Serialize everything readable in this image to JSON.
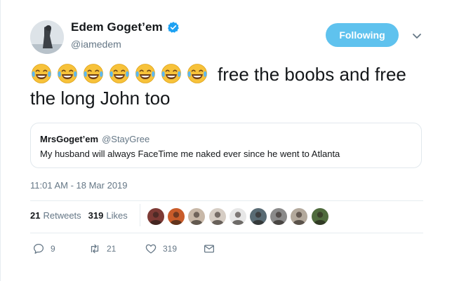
{
  "author": {
    "display_name": "Edem Goget’em",
    "handle": "@iamedem",
    "verified": true
  },
  "follow_button": {
    "label": "Following"
  },
  "tweet": {
    "text": "free the boobs and free the long John too",
    "emoji_count": 7
  },
  "quoted_tweet": {
    "display_name": "MrsGoget’em",
    "handle": "@StayGree",
    "text": "My husband will always FaceTime me naked ever since he went to Atlanta"
  },
  "timestamp": "11:01 AM - 18 Mar 2019",
  "stats": {
    "retweets_count": "21",
    "retweets_label": "Retweets",
    "likes_count": "319",
    "likes_label": "Likes"
  },
  "likers": [
    "#7d3a35",
    "#c95c2a",
    "#c8b8a8",
    "#d6cdc4",
    "#e7e7e7",
    "#596b74",
    "#8a8a8a",
    "#b3a99c",
    "#4f6b3d"
  ],
  "actions": {
    "reply_count": "9",
    "retweet_count": "21",
    "like_count": "319"
  },
  "colors": {
    "accent": "#1da1f2",
    "follow_bg": "#5fc2ee",
    "muted": "#657786"
  }
}
